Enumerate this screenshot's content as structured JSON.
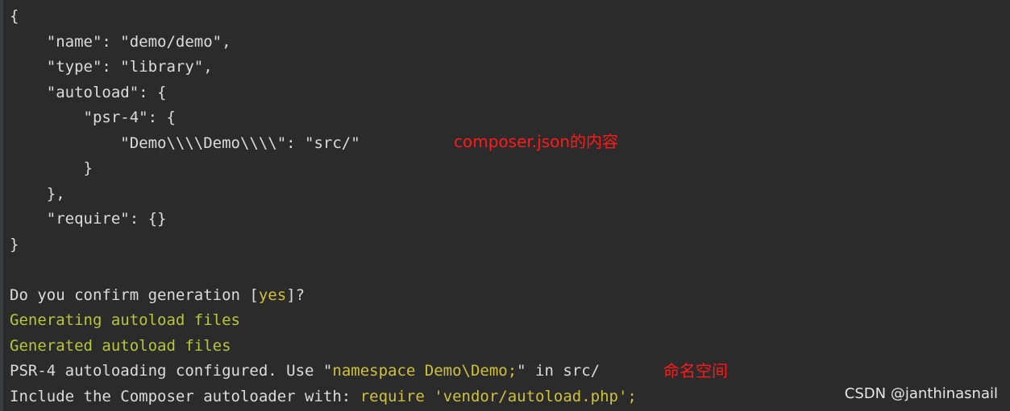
{
  "json_block": {
    "lines": [
      "{",
      "    \"name\": \"demo/demo\",",
      "    \"type\": \"library\",",
      "    \"autoload\": {",
      "        \"psr-4\": {",
      "            \"Demo\\\\\\\\Demo\\\\\\\\\": \"src/\"",
      "        }",
      "    },",
      "    \"require\": {}",
      "}"
    ]
  },
  "prompt": {
    "before": "Do you confirm generation [",
    "answer": "yes",
    "after": "]?"
  },
  "status": {
    "generating": "Generating autoload files",
    "generated": "Generated autoload files"
  },
  "psr4_line": {
    "before": "PSR-4 autoloading configured. Use \"",
    "highlight": "namespace Demo\\Demo;",
    "after": "\" in src/"
  },
  "include_line": {
    "before": "Include the Composer autoloader with: ",
    "highlight": "require 'vendor/autoload.php';"
  },
  "annotations": {
    "composer_json": "composer.json的内容",
    "namespace": "命名空间"
  },
  "watermark": "CSDN @janthinasnail",
  "colors": {
    "background": "#2b2b2b",
    "text": "#dcdcdc",
    "highlight": "#cfc13a",
    "success": "#b8c637",
    "annotation": "#ff1a1a"
  }
}
